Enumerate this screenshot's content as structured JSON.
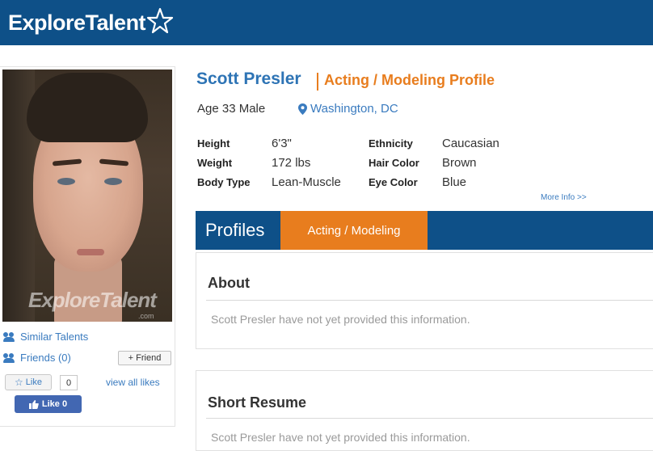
{
  "header": {
    "logo_part1": "Explore",
    "logo_part2": "Talent"
  },
  "photo": {
    "watermark": "ExploreTalent",
    "watermark_sub": ".com"
  },
  "sidebar": {
    "similar_talents": "Similar Talents",
    "friends": "Friends (0)",
    "add_friend": "+ Friend",
    "like_label": "Like",
    "like_count": "0",
    "view_all_likes": "view all likes",
    "fb_like": "Like 0"
  },
  "profile": {
    "name": "Scott Presler",
    "type": "Acting / Modeling Profile",
    "age_sex": "Age 33 Male",
    "location": "Washington, DC",
    "attributes": [
      {
        "label": "Height",
        "value": "6'3\""
      },
      {
        "label": "Weight",
        "value": "172 lbs"
      },
      {
        "label": "Body Type",
        "value": "Lean-Muscle"
      },
      {
        "label": "Ethnicity",
        "value": "Caucasian"
      },
      {
        "label": "Hair Color",
        "value": "Brown"
      },
      {
        "label": "Eye Color",
        "value": "Blue"
      }
    ],
    "more_info": "More Info >>"
  },
  "tabs": {
    "profiles": "Profiles",
    "acting": "Acting / Modeling"
  },
  "sections": {
    "about_title": "About",
    "about_text": "Scott Presler have not yet provided this information.",
    "resume_title": "Short Resume",
    "resume_text": "Scott Presler have not yet provided this information."
  },
  "colors": {
    "brand_blue": "#0e5088",
    "accent_orange": "#e87d1e",
    "link_blue": "#3a7bbf"
  }
}
